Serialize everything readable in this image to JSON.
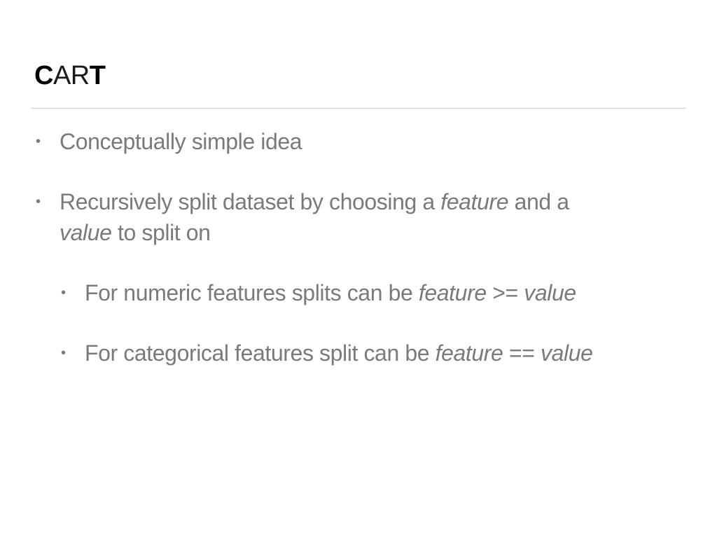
{
  "slide": {
    "title": {
      "c": "C",
      "ar": "AR",
      "t": "T"
    },
    "bullets": [
      {
        "marker": "•",
        "text": "Conceptually simple idea"
      },
      {
        "marker": "•",
        "line1_a": "Recursively split dataset by choosing a ",
        "line1_em": "feature",
        "line1_b": " and a",
        "line2_em": "value",
        "line2_b": " to split on"
      },
      {
        "marker": "•",
        "a": "For numeric features splits can be ",
        "em1": "feature",
        "op": " >= ",
        "em2": "value"
      },
      {
        "marker": "•",
        "a": "For categorical features split can be ",
        "em1": "feature",
        "op": " == ",
        "em2": "value"
      }
    ]
  }
}
